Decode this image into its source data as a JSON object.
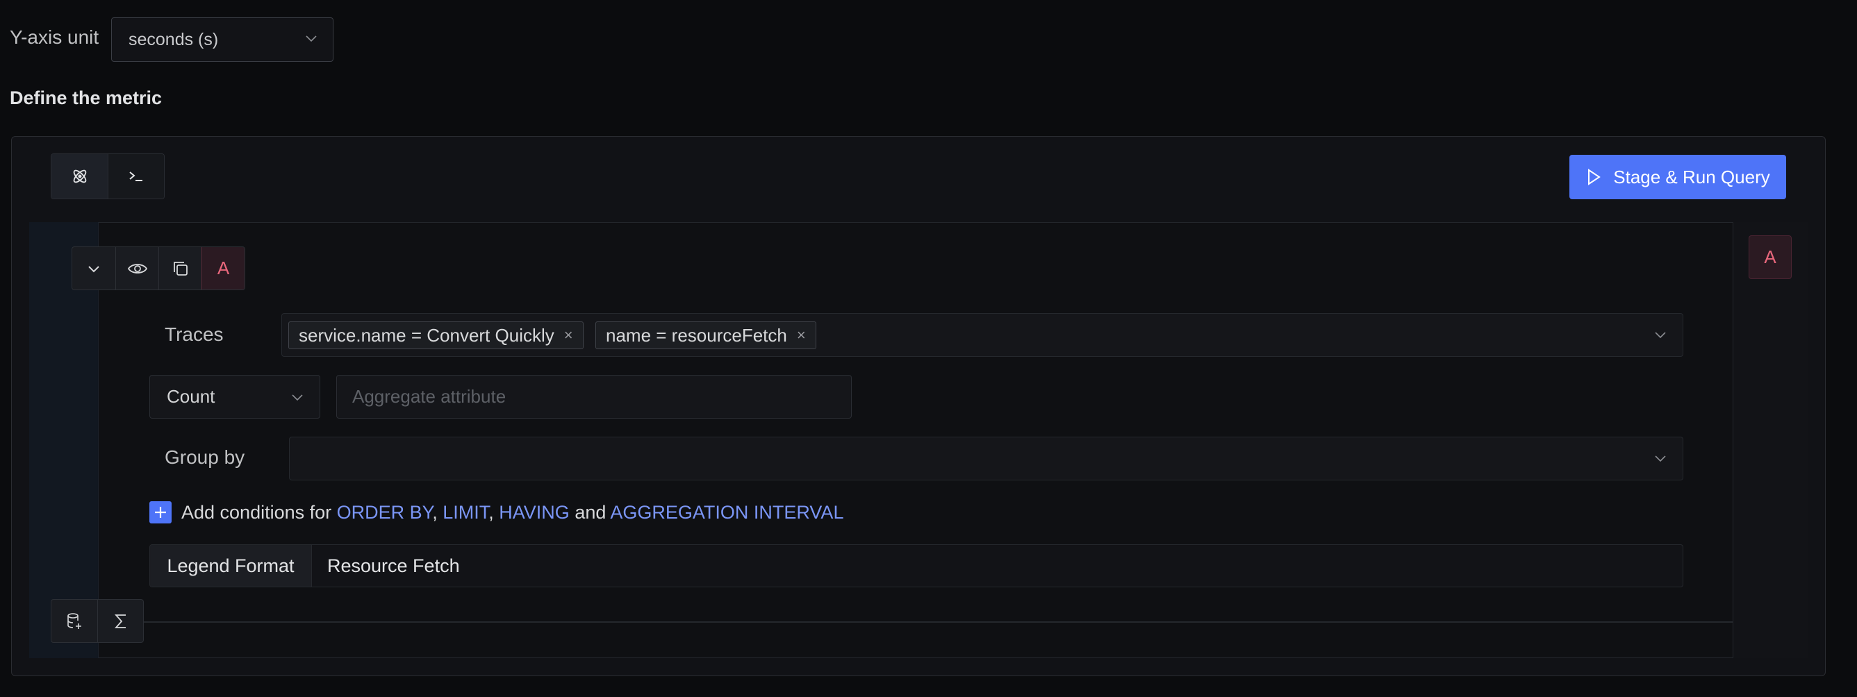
{
  "yaxis": {
    "label": "Y-axis unit",
    "selected": "seconds (s)"
  },
  "define": {
    "title": "Define the metric"
  },
  "toolbar": {
    "mode_icons": [
      "query-builder-icon",
      "terminal-icon"
    ],
    "run_label": "Stage & Run Query"
  },
  "query": {
    "letter": "A",
    "side_letter": "A",
    "traces_label": "Traces",
    "filters": [
      {
        "text": "service.name = Convert Quickly"
      },
      {
        "text": "name = resourceFetch"
      }
    ],
    "remove_glyph": "×",
    "aggregate_op": "Count",
    "aggregate_placeholder": "Aggregate attribute",
    "groupby_label": "Group by",
    "add_conditions": {
      "prefix": "Add conditions for",
      "order_by": "ORDER BY",
      "comma1": ",",
      "limit": "LIMIT",
      "comma2": ",",
      "having": "HAVING",
      "and": "and",
      "interval": "AGGREGATION INTERVAL"
    },
    "legend_label": "Legend Format",
    "legend_value": "Resource Fetch"
  },
  "colors": {
    "accent": "#4e74f8",
    "query_letter": "#e8677c",
    "link": "#7b96f6"
  }
}
